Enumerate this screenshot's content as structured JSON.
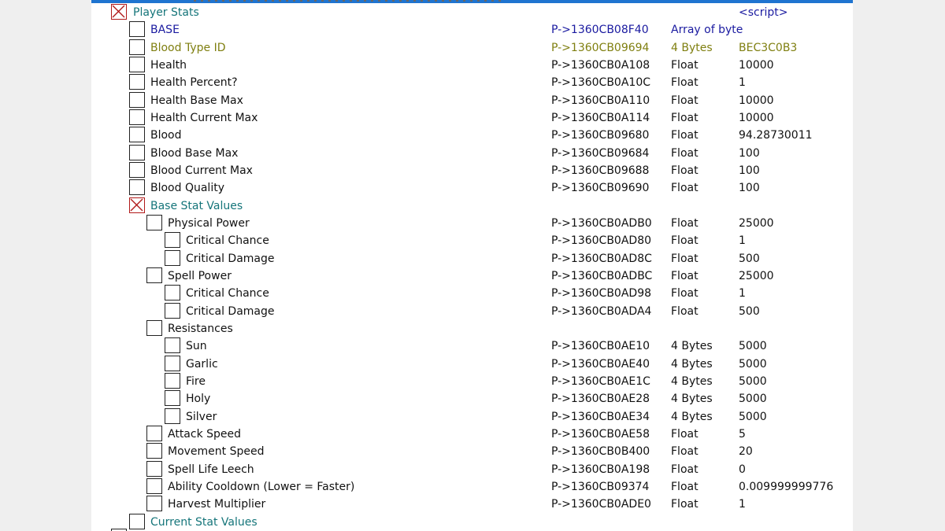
{
  "colors": {
    "group_text": "#15757a",
    "base_text": "#1a1aa0",
    "blood_type_text": "#7f7f10",
    "normal_text": "#111111",
    "checked_box": "#b11a1a",
    "top_bar": "#1f74d0"
  },
  "icons": {
    "checked": "x-cross-icon",
    "unchecked": "empty-checkbox-icon"
  },
  "rows": [
    {
      "description": "Player Stats",
      "address": "",
      "type": "",
      "value": "<script>",
      "checked": true,
      "style": "group"
    },
    {
      "description": "BASE",
      "address": "P->1360CB08F40",
      "type": "Array of byte",
      "value": "",
      "checked": false,
      "style": "blue"
    },
    {
      "description": "Blood Type ID",
      "address": "P->1360CB09694",
      "type": "4 Bytes",
      "value": "BEC3C0B3",
      "checked": false,
      "style": "olive"
    },
    {
      "description": "Health",
      "address": "P->1360CB0A108",
      "type": "Float",
      "value": "10000",
      "checked": false,
      "style": "normal"
    },
    {
      "description": "Health Percent?",
      "address": "P->1360CB0A10C",
      "type": "Float",
      "value": "1",
      "checked": false,
      "style": "normal"
    },
    {
      "description": "Health Base Max",
      "address": "P->1360CB0A110",
      "type": "Float",
      "value": "10000",
      "checked": false,
      "style": "normal"
    },
    {
      "description": "Health Current Max",
      "address": "P->1360CB0A114",
      "type": "Float",
      "value": "10000",
      "checked": false,
      "style": "normal"
    },
    {
      "description": "Blood",
      "address": "P->1360CB09680",
      "type": "Float",
      "value": "94.28730011",
      "checked": false,
      "style": "normal"
    },
    {
      "description": "Blood Base Max",
      "address": "P->1360CB09684",
      "type": "Float",
      "value": "100",
      "checked": false,
      "style": "normal"
    },
    {
      "description": "Blood Current Max",
      "address": "P->1360CB09688",
      "type": "Float",
      "value": "100",
      "checked": false,
      "style": "normal"
    },
    {
      "description": "Blood Quality",
      "address": "P->1360CB09690",
      "type": "Float",
      "value": "100",
      "checked": false,
      "style": "normal"
    },
    {
      "description": "Base Stat Values",
      "address": "",
      "type": "",
      "value": "",
      "checked": true,
      "style": "group"
    },
    {
      "description": "Physical Power",
      "address": "P->1360CB0ADB0",
      "type": "Float",
      "value": "25000",
      "checked": false,
      "style": "normal"
    },
    {
      "description": "Critical Chance",
      "address": "P->1360CB0AD80",
      "type": "Float",
      "value": "1",
      "checked": false,
      "style": "normal"
    },
    {
      "description": "Critical Damage",
      "address": "P->1360CB0AD8C",
      "type": "Float",
      "value": "500",
      "checked": false,
      "style": "normal"
    },
    {
      "description": "Spell Power",
      "address": "P->1360CB0ADBC",
      "type": "Float",
      "value": "25000",
      "checked": false,
      "style": "normal"
    },
    {
      "description": "Critical Chance",
      "address": "P->1360CB0AD98",
      "type": "Float",
      "value": "1",
      "checked": false,
      "style": "normal"
    },
    {
      "description": "Critical Damage",
      "address": "P->1360CB0ADA4",
      "type": "Float",
      "value": "500",
      "checked": false,
      "style": "normal"
    },
    {
      "description": "Resistances",
      "address": "",
      "type": "",
      "value": "",
      "checked": false,
      "style": "normal"
    },
    {
      "description": "Sun",
      "address": "P->1360CB0AE10",
      "type": "4 Bytes",
      "value": "5000",
      "checked": false,
      "style": "normal"
    },
    {
      "description": "Garlic",
      "address": "P->1360CB0AE40",
      "type": "4 Bytes",
      "value": "5000",
      "checked": false,
      "style": "normal"
    },
    {
      "description": "Fire",
      "address": "P->1360CB0AE1C",
      "type": "4 Bytes",
      "value": "5000",
      "checked": false,
      "style": "normal"
    },
    {
      "description": "Holy",
      "address": "P->1360CB0AE28",
      "type": "4 Bytes",
      "value": "5000",
      "checked": false,
      "style": "normal"
    },
    {
      "description": "Silver",
      "address": "P->1360CB0AE34",
      "type": "4 Bytes",
      "value": "5000",
      "checked": false,
      "style": "normal"
    },
    {
      "description": "Attack Speed",
      "address": "P->1360CB0AE58",
      "type": "Float",
      "value": "5",
      "checked": false,
      "style": "normal"
    },
    {
      "description": "Movement Speed",
      "address": "P->1360CB0B400",
      "type": "Float",
      "value": "20",
      "checked": false,
      "style": "normal"
    },
    {
      "description": "Spell Life Leech",
      "address": "P->1360CB0A198",
      "type": "Float",
      "value": "0",
      "checked": false,
      "style": "normal"
    },
    {
      "description": "Ability Cooldown (Lower = Faster)",
      "address": "P->1360CB09374",
      "type": "Float",
      "value": "0.009999999776",
      "checked": false,
      "style": "normal"
    },
    {
      "description": "Harvest Multiplier",
      "address": "P->1360CB0ADE0",
      "type": "Float",
      "value": "1",
      "checked": false,
      "style": "normal"
    },
    {
      "description": "Current Stat Values",
      "address": "",
      "type": "",
      "value": "",
      "checked": false,
      "style": "group"
    }
  ]
}
